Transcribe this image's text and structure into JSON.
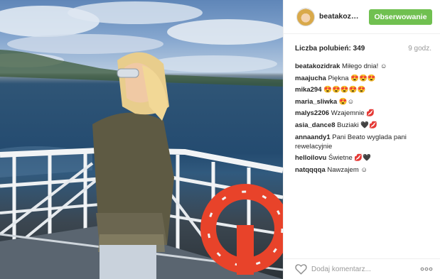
{
  "post": {
    "photo_label": "photo of woman on ferry deck",
    "username": "beatakozidrak",
    "follow_label": "Obserwowanie",
    "likes_label": "Liczba polubień:",
    "likes_count": "349",
    "time_ago": "9 godz.",
    "comments": [
      {
        "user": "beatakozidrak",
        "text": "Miłego dnia! ☺"
      },
      {
        "user": "maajucha",
        "text": "Piękna 😍😍😍"
      },
      {
        "user": "mika294",
        "text": "😍😍😍😍😍"
      },
      {
        "user": "maria_sliwka",
        "text": "😍☺"
      },
      {
        "user": "malys2206",
        "text": "Wzajemnie 💋"
      },
      {
        "user": "asia_dance8",
        "text": "Buziaki 🖤💋"
      },
      {
        "user": "annaandy1",
        "text": "Pani Beato wyglada pani rewelacyjnie"
      },
      {
        "user": "helloilovu",
        "text": "Świetne 💋🖤"
      },
      {
        "user": "natqqqqa",
        "text": "Nawzajem ☺"
      }
    ],
    "comment_placeholder": "Dodaj komentarz...",
    "icons": {
      "like": "heart-outline-icon",
      "more": "more-options-icon"
    },
    "colors": {
      "follow_button": "#70c050",
      "meta": "#999999"
    }
  }
}
